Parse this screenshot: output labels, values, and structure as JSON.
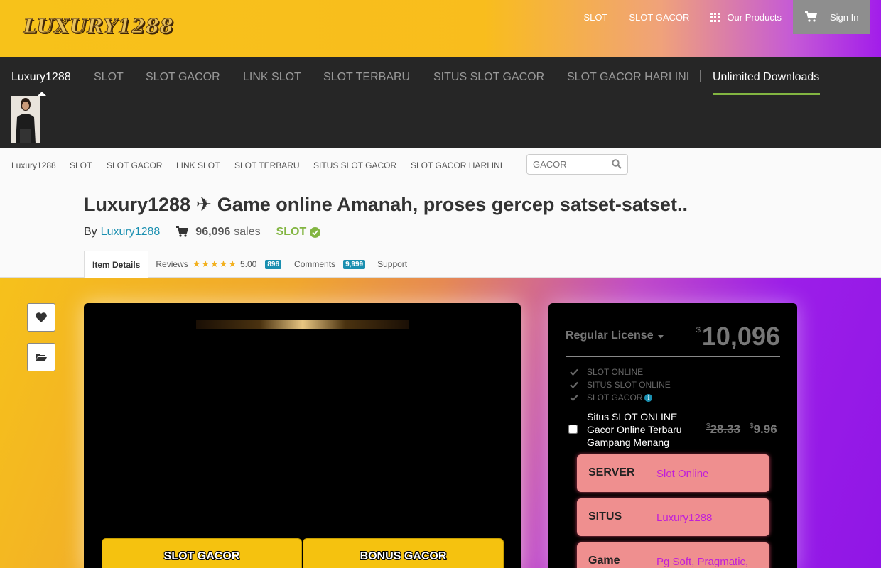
{
  "topbar": {
    "logo_text": "LUXURY1288",
    "links": [
      "SLOT",
      "SLOT GACOR",
      "Our Products"
    ],
    "signin": "Sign In"
  },
  "darknav": {
    "items": [
      "Luxury1288",
      "SLOT",
      "SLOT GACOR",
      "LINK SLOT",
      "SLOT TERBARU",
      "SITUS SLOT GACOR",
      "SLOT GACOR HARI INI"
    ],
    "unlimited": "Unlimited Downloads"
  },
  "subnav": {
    "items": [
      "Luxury1288",
      "SLOT",
      "SLOT GACOR",
      "LINK SLOT",
      "SLOT TERBARU",
      "SITUS SLOT GACOR",
      "SLOT GACOR HARI INI"
    ],
    "search_placeholder": "GACOR"
  },
  "item": {
    "title": "Luxury1288 ✈ Game online Amanah, proses gercep satset-satset..",
    "by": "By",
    "author": "Luxury1288",
    "sales": "96,096",
    "sales_word": "sales",
    "category": "SLOT"
  },
  "tabs": {
    "details": "Item Details",
    "reviews": "Reviews",
    "rating": "5.00",
    "review_count": "896",
    "comments": "Comments",
    "comment_count": "9,999",
    "support": "Support"
  },
  "preview": {
    "btn_left": "SLOT GACOR",
    "btn_right": "BONUS GACOR"
  },
  "license": {
    "title": "Regular License",
    "currency": "$",
    "price": "10,096",
    "features": [
      "SLOT ONLINE",
      "SITUS SLOT ONLINE",
      "SLOT GACOR"
    ],
    "addon_text": "Situs SLOT ONLINE Gacor Online Terbaru Gampang Menang",
    "addon_old_price": "28.33",
    "addon_new_price": "9.96",
    "cards": [
      {
        "key": "SERVER",
        "value": "Slot Online"
      },
      {
        "key": "SITUS",
        "value": "Luxury1288"
      },
      {
        "key": "Game",
        "value": "Pg Soft, Pragmatic,"
      }
    ]
  },
  "colors": {
    "accent_green": "#82b541",
    "link_blue": "#1a8fb0",
    "yellow": "#f6c11b",
    "purple": "#9c1ee8"
  }
}
